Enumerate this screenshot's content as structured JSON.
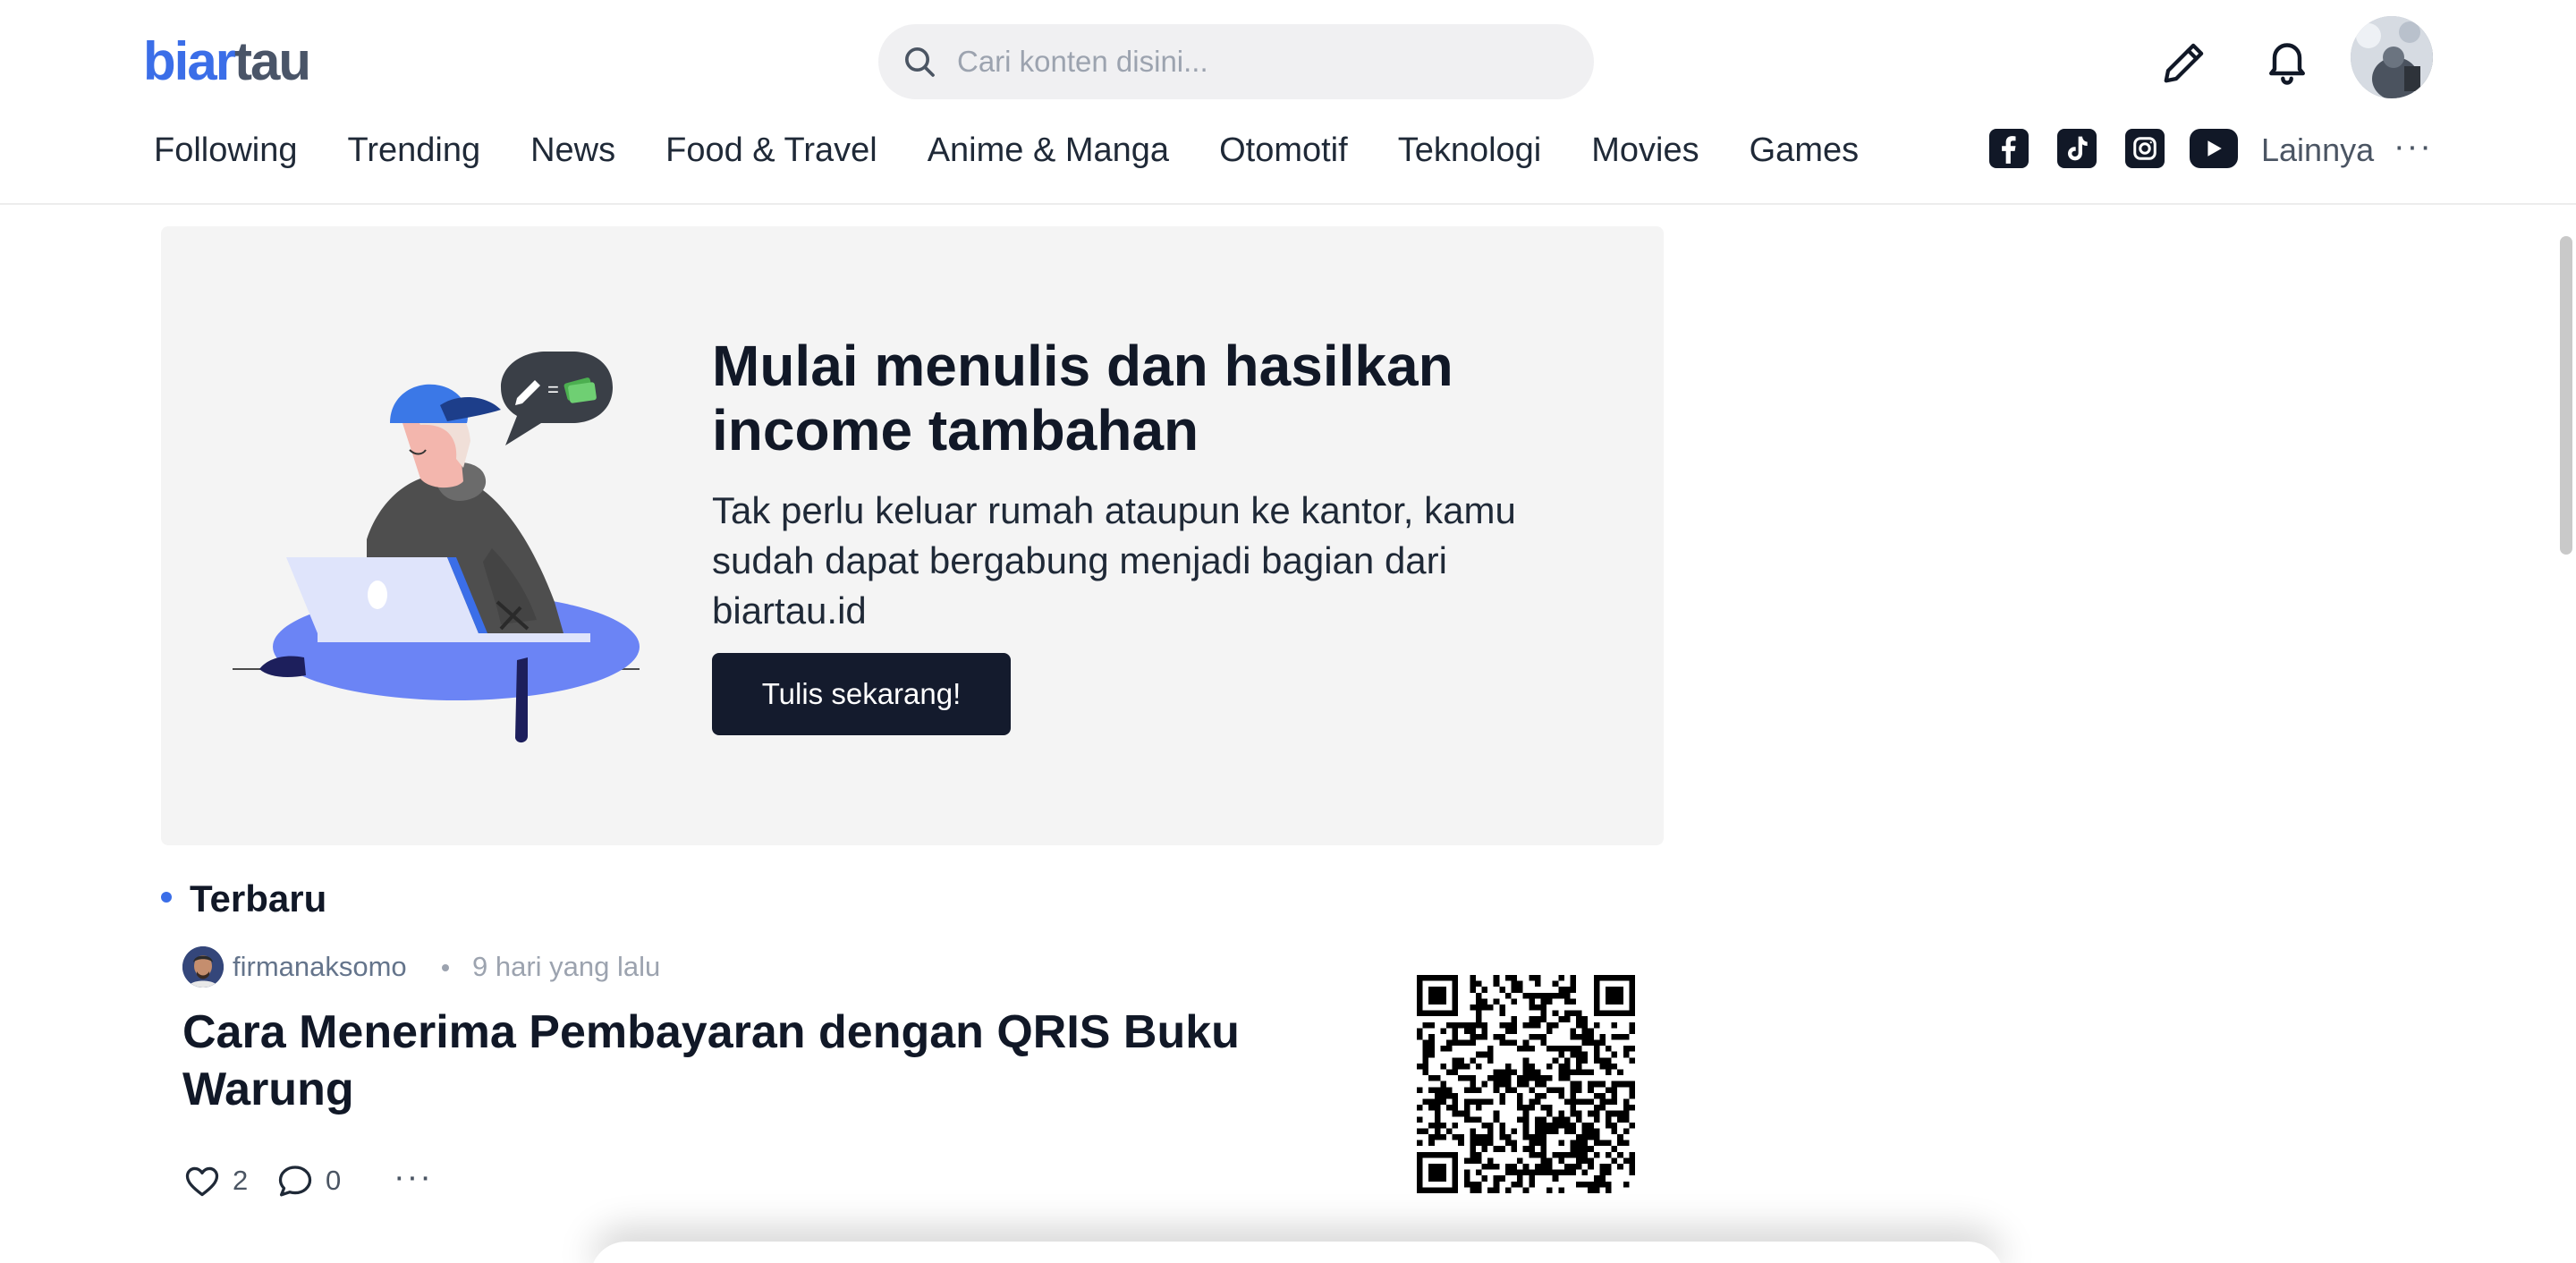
{
  "header": {
    "logo_part1": "biar",
    "logo_part2": "tau",
    "search_placeholder": "Cari konten disini...",
    "icons": [
      "search-icon",
      "pencil-icon",
      "bell-icon",
      "avatar"
    ],
    "brand_color": "#3b6ee8"
  },
  "nav": {
    "items": [
      {
        "label": "Following"
      },
      {
        "label": "Trending"
      },
      {
        "label": "News"
      },
      {
        "label": "Food & Travel"
      },
      {
        "label": "Anime & Manga"
      },
      {
        "label": "Otomotif"
      },
      {
        "label": "Teknologi"
      },
      {
        "label": "Movies"
      },
      {
        "label": "Games"
      }
    ],
    "social_icons": [
      "facebook-icon",
      "tiktok-icon",
      "instagram-icon",
      "youtube-icon"
    ],
    "more_label": "Lainnya",
    "more_dots": "···"
  },
  "banner": {
    "title": "Mulai menulis dan hasilkan income tambahan",
    "description": "Tak perlu keluar rumah ataupun ke kantor, kamu sudah dapat bergabung menjadi bagian dari biartau.id",
    "cta_label": "Tulis sekarang!",
    "bubble_equals": "=",
    "background_color": "#f4f4f4",
    "cta_color": "#141b2d"
  },
  "feed": {
    "section_title": "Terbaru",
    "posts": [
      {
        "author": "firmanaksomo",
        "time": "9 hari yang lalu",
        "title": "Cara Menerima Pembayaran dengan QRIS Buku Warung",
        "likes": "2",
        "comments": "0",
        "more": "···",
        "thumbnail": "qr-code-image"
      }
    ]
  }
}
